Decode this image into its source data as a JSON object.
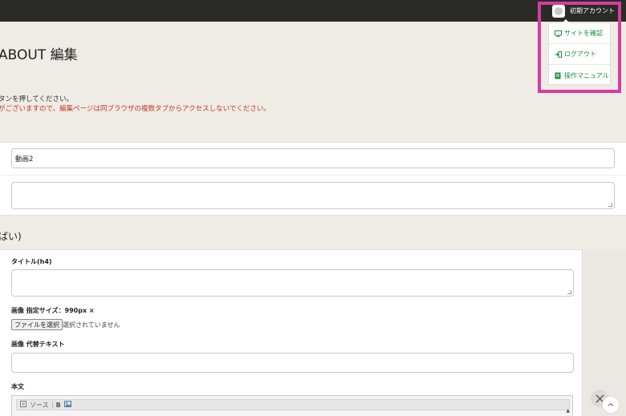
{
  "header": {
    "account_name": "初期アカウント"
  },
  "account_menu": {
    "items": [
      {
        "label": "サイトを確認",
        "icon": "monitor-icon"
      },
      {
        "label": "ログアウト",
        "icon": "logout-icon"
      },
      {
        "label": "操作マニュアル",
        "icon": "book-icon"
      }
    ]
  },
  "page": {
    "title": "ABOUT 編集",
    "notice_line1": "タンを押してください。",
    "notice_line2": "がございますので、編集ページは同ブラウザの複数タブからアクセスしないでください。"
  },
  "top_form": {
    "name_value": "動画2",
    "description_value": ""
  },
  "section": {
    "heading": "ばい)"
  },
  "block_form": {
    "title_label": "タイトル(h4)",
    "title_value": "",
    "image_label": "画像 指定サイズ：990px ×",
    "file_button": "ファイルを選択",
    "file_status": "選択されていません",
    "alt_label": "画像 代替テキスト",
    "alt_value": "",
    "body_label": "本文",
    "editor_source": "ソース",
    "editor_bold": "B"
  },
  "colors": {
    "topbar": "#2a2a27",
    "menu_link": "#1e8f3f",
    "notice_red": "#c0392b",
    "highlight": "#d63da0",
    "background": "#efebe5"
  }
}
